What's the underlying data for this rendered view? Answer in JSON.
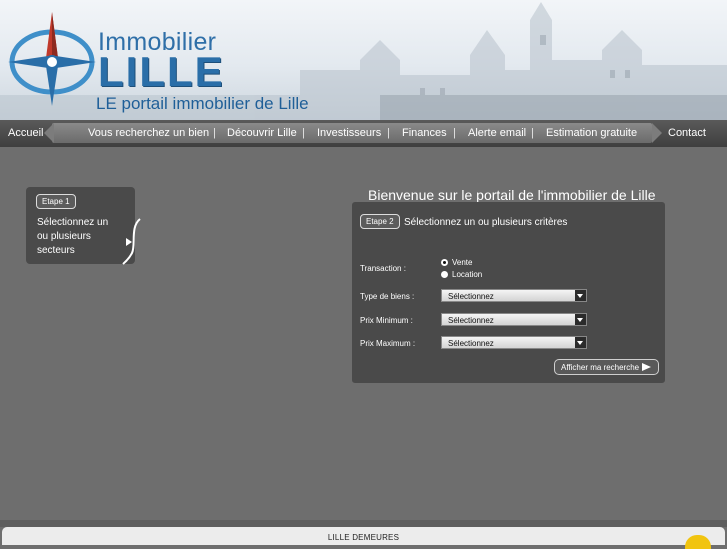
{
  "header": {
    "logo_word1": "Immobilier",
    "logo_word2": "LILLE",
    "tagline": "LE portail immobilier de Lille",
    "brand_color": "#2a6ea8"
  },
  "nav": {
    "home": "Accueil",
    "items": [
      "Vous recherchez un bien",
      "Découvrir Lille",
      "Investisseurs",
      "Finances",
      "Alerte email",
      "Estimation gratuite"
    ],
    "separator": "|",
    "contact": "Contact"
  },
  "step1": {
    "badge": "Etape 1",
    "text": "Sélectionnez un ou plusieurs secteurs"
  },
  "welcome": "Bienvenue sur le portail de l'immobilier de Lille",
  "step2": {
    "badge": "Etape 2",
    "title": "Sélectionnez un ou plusieurs critères",
    "transaction_label": "Transaction :",
    "radio_vente": "Vente",
    "radio_location": "Location",
    "selected_transaction": "Vente",
    "type_label": "Type de biens :",
    "type_value": "Sélectionnez",
    "prix_min_label": "Prix Minimum :",
    "prix_min_value": "Sélectionnez",
    "prix_max_label": "Prix Maximum :",
    "prix_max_value": "Sélectionnez",
    "submit_label": "Afficher ma recherche"
  },
  "footer": {
    "text": "LILLE DEMEURES"
  }
}
